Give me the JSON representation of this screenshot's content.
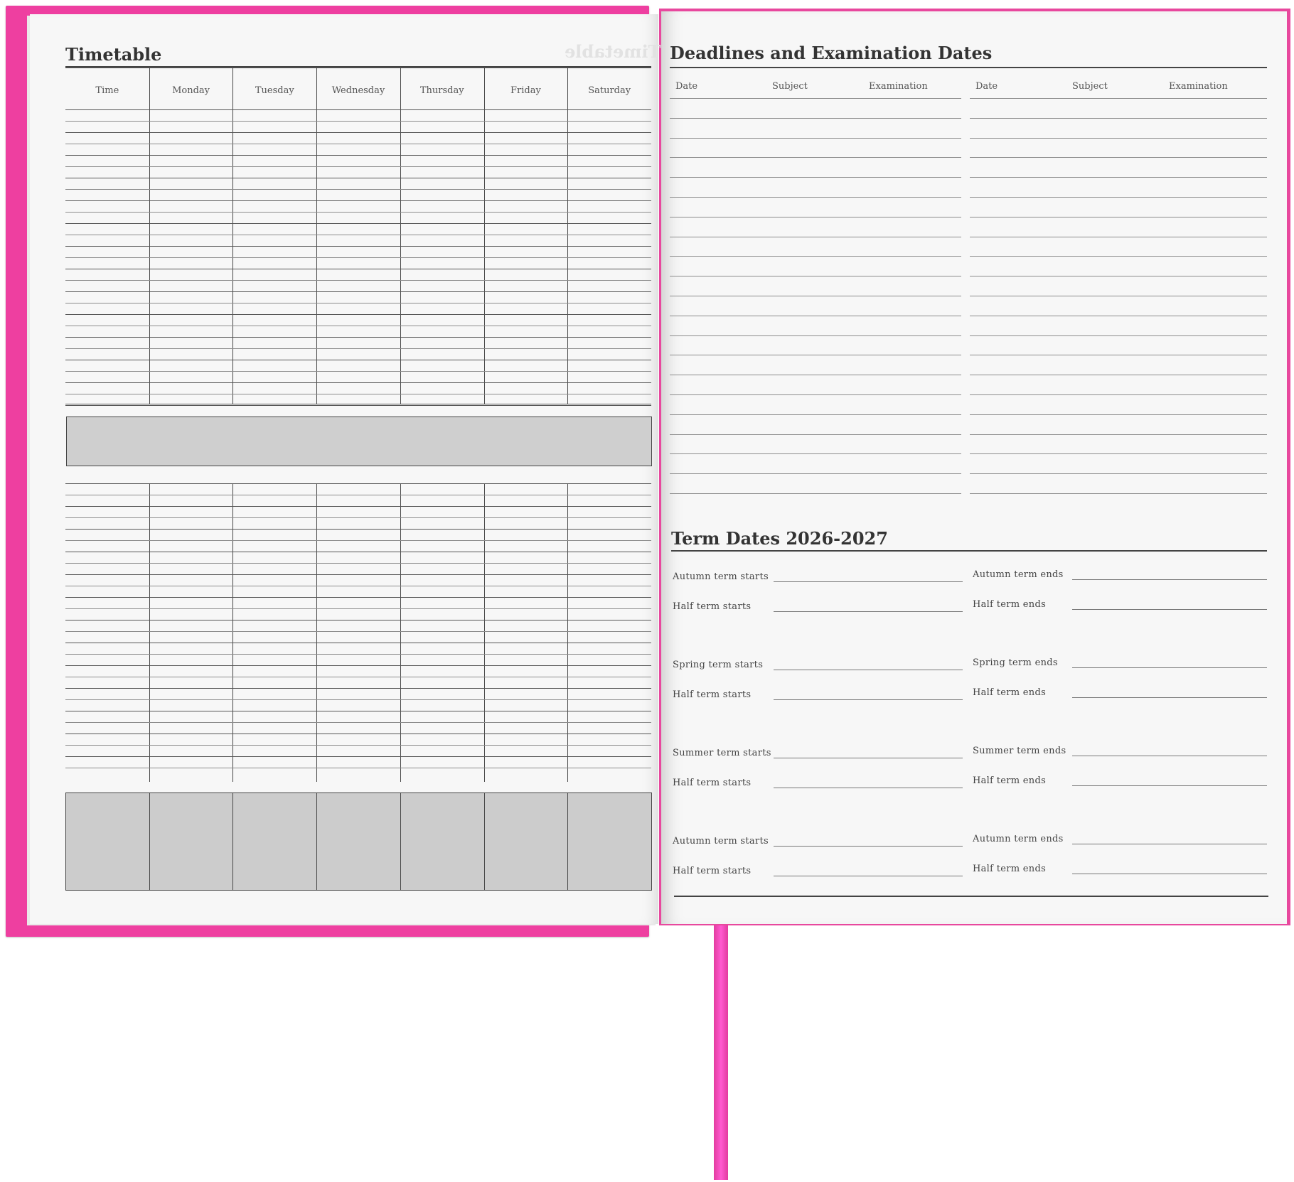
{
  "left_page": {
    "title": "Timetable",
    "columns": [
      "Time",
      "Monday",
      "Tuesday",
      "Wednesday",
      "Thursday",
      "Friday",
      "Saturday"
    ]
  },
  "right_page": {
    "deadlines_title": "Deadlines and Examination Dates",
    "deadline_columns": [
      "Date",
      "Subject",
      "Examination",
      "Date",
      "Subject",
      "Examination"
    ],
    "term_title": "Term Dates 2026-2027",
    "term_rows": [
      {
        "left": "Autumn term starts",
        "right": "Autumn term ends"
      },
      {
        "left": "Half term starts",
        "right": "Half term ends"
      },
      {
        "left": "Spring term starts",
        "right": "Spring term ends"
      },
      {
        "left": "Half term starts",
        "right": "Half term ends"
      },
      {
        "left": "Summer term starts",
        "right": "Summer term ends"
      },
      {
        "left": "Half term starts",
        "right": "Half term ends"
      },
      {
        "left": "Autumn term starts",
        "right": "Autumn term ends"
      },
      {
        "left": "Half term starts",
        "right": "Half term ends"
      }
    ]
  },
  "colors": {
    "cover": "#ee3fa0",
    "ribbon": "#ff5ad0",
    "page": "#f7f7f7",
    "shaded_cell": "#cccccc"
  }
}
